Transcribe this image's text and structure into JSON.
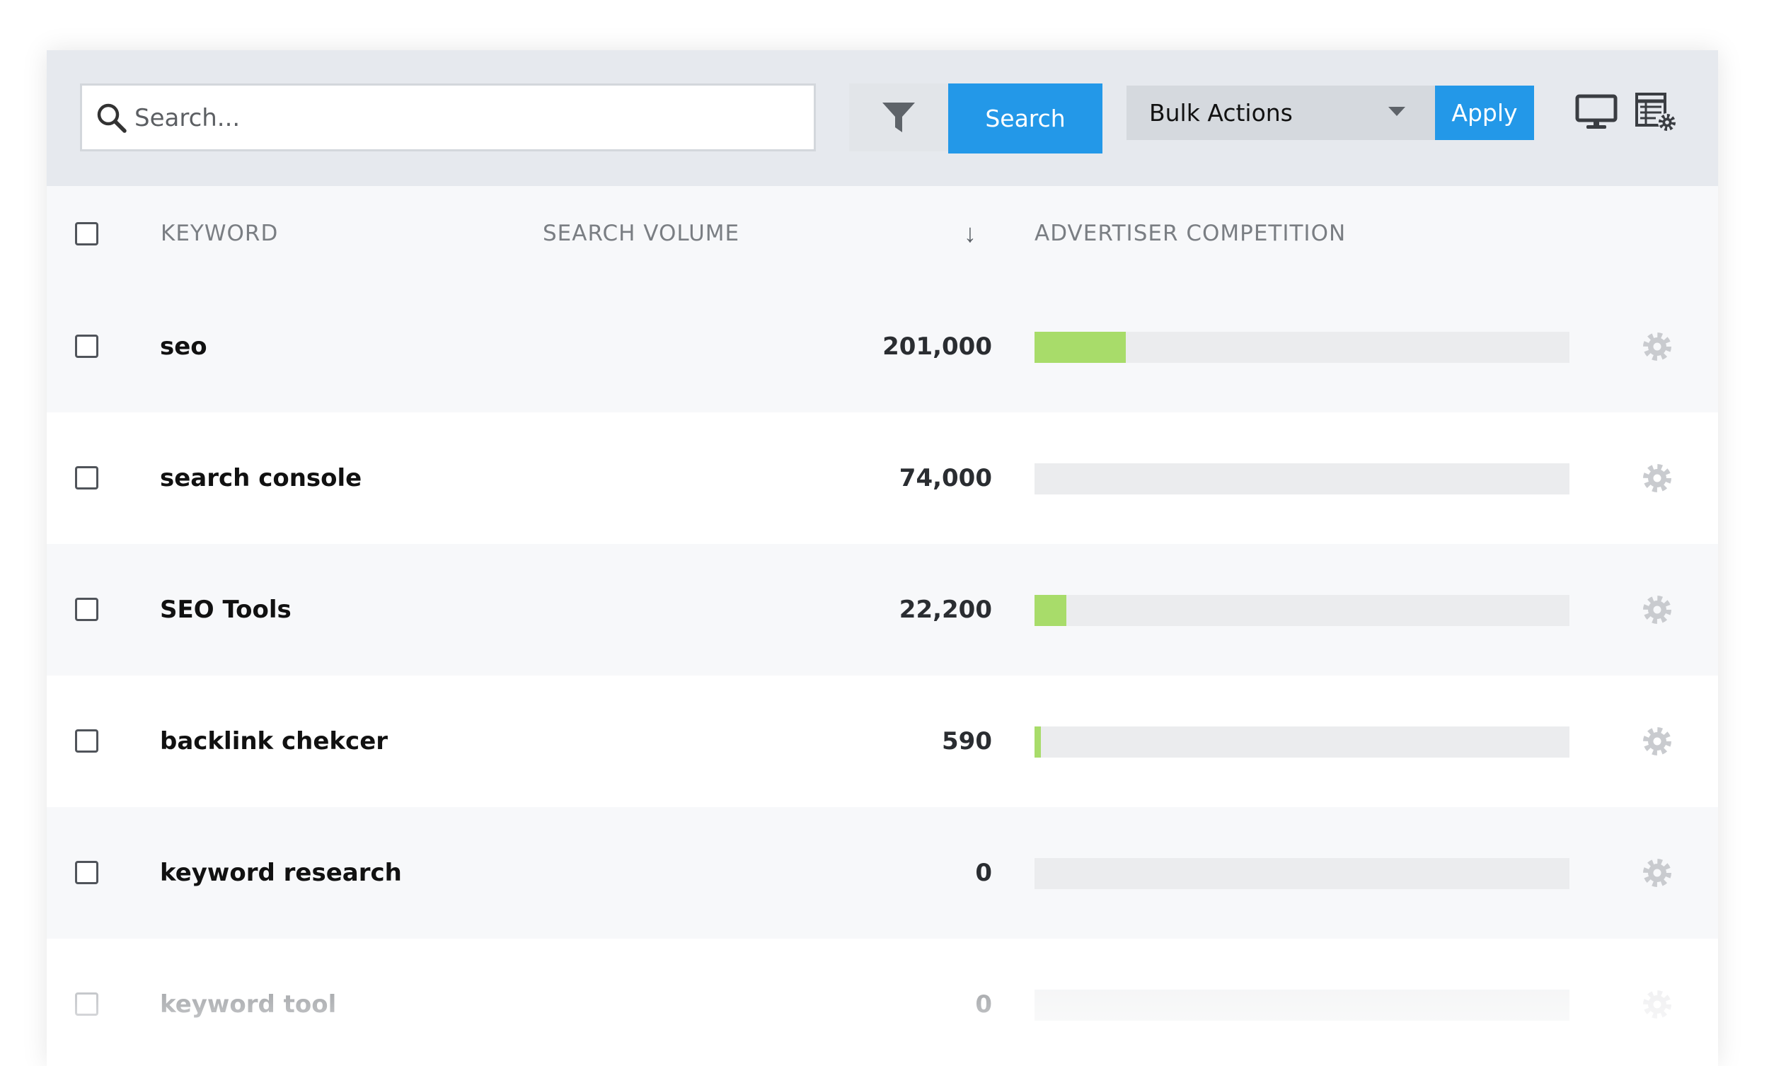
{
  "toolbar": {
    "search_placeholder": "Search...",
    "search_button_label": "Search",
    "bulk_actions_label": "Bulk Actions",
    "apply_button_label": "Apply",
    "icons": [
      "search-icon",
      "filter-icon",
      "monitor-icon",
      "table-settings-icon"
    ]
  },
  "table": {
    "headers": {
      "keyword": "KEYWORD",
      "search_volume": "SEARCH VOLUME",
      "sort_indicator": "↓",
      "advertiser_competition": "ADVERTISER COMPETITION"
    },
    "rows": [
      {
        "keyword": "seo",
        "search_volume": "201,000",
        "competition_fraction": 0.17
      },
      {
        "keyword": "search console",
        "search_volume": "74,000",
        "competition_fraction": 0.0
      },
      {
        "keyword": "SEO Tools",
        "search_volume": "22,200",
        "competition_fraction": 0.06
      },
      {
        "keyword": "backlink chekcer",
        "search_volume": "590",
        "competition_fraction": 0.012
      },
      {
        "keyword": "keyword research",
        "search_volume": "0",
        "competition_fraction": 0.0
      },
      {
        "keyword": "keyword tool",
        "search_volume": "0",
        "competition_fraction": 0.0
      }
    ]
  },
  "colors": {
    "primary_button": "#2398e8",
    "competition_bar": "#a8dc6a",
    "toolbar_bg": "#e6e9ee",
    "alt_row_bg": "#f7f8fa"
  }
}
